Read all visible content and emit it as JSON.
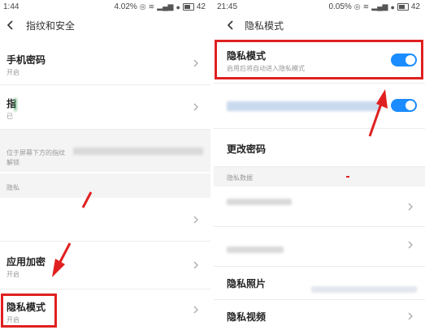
{
  "left": {
    "status": {
      "time": "1:44",
      "battery_text": "4.02%",
      "battery_level": "42"
    },
    "header": {
      "title": "指纹和安全"
    },
    "items": [
      {
        "title": "手机密码",
        "subtitle": "开启"
      },
      {
        "title": "指",
        "subtitle": "已"
      }
    ],
    "desc": {
      "line1": "位于屏幕下方的指纹",
      "line2": "解锁"
    },
    "section_label": "隐私",
    "app_lock": {
      "title": "应用加密",
      "subtitle": "开启"
    },
    "privacy_mode": {
      "title": "隐私模式",
      "subtitle": "开启"
    }
  },
  "right": {
    "status": {
      "time": "21:45",
      "battery_text": "0.05%",
      "battery_level": "42"
    },
    "header": {
      "title": "隐私模式"
    },
    "privacy_mode": {
      "title": "隐私模式",
      "subtitle": "启用后将自动进入隐私模式",
      "enabled": true
    },
    "second_toggle": {
      "enabled": true
    },
    "change_password": {
      "title": "更改密码"
    },
    "section_label": "隐私数据",
    "photos": {
      "title": "隐私照片"
    },
    "videos": {
      "title": "隐私视频"
    }
  },
  "colors": {
    "highlight": "#e02020",
    "toggle_on": "#1a8cff",
    "section_bg": "#f4f4f4"
  }
}
